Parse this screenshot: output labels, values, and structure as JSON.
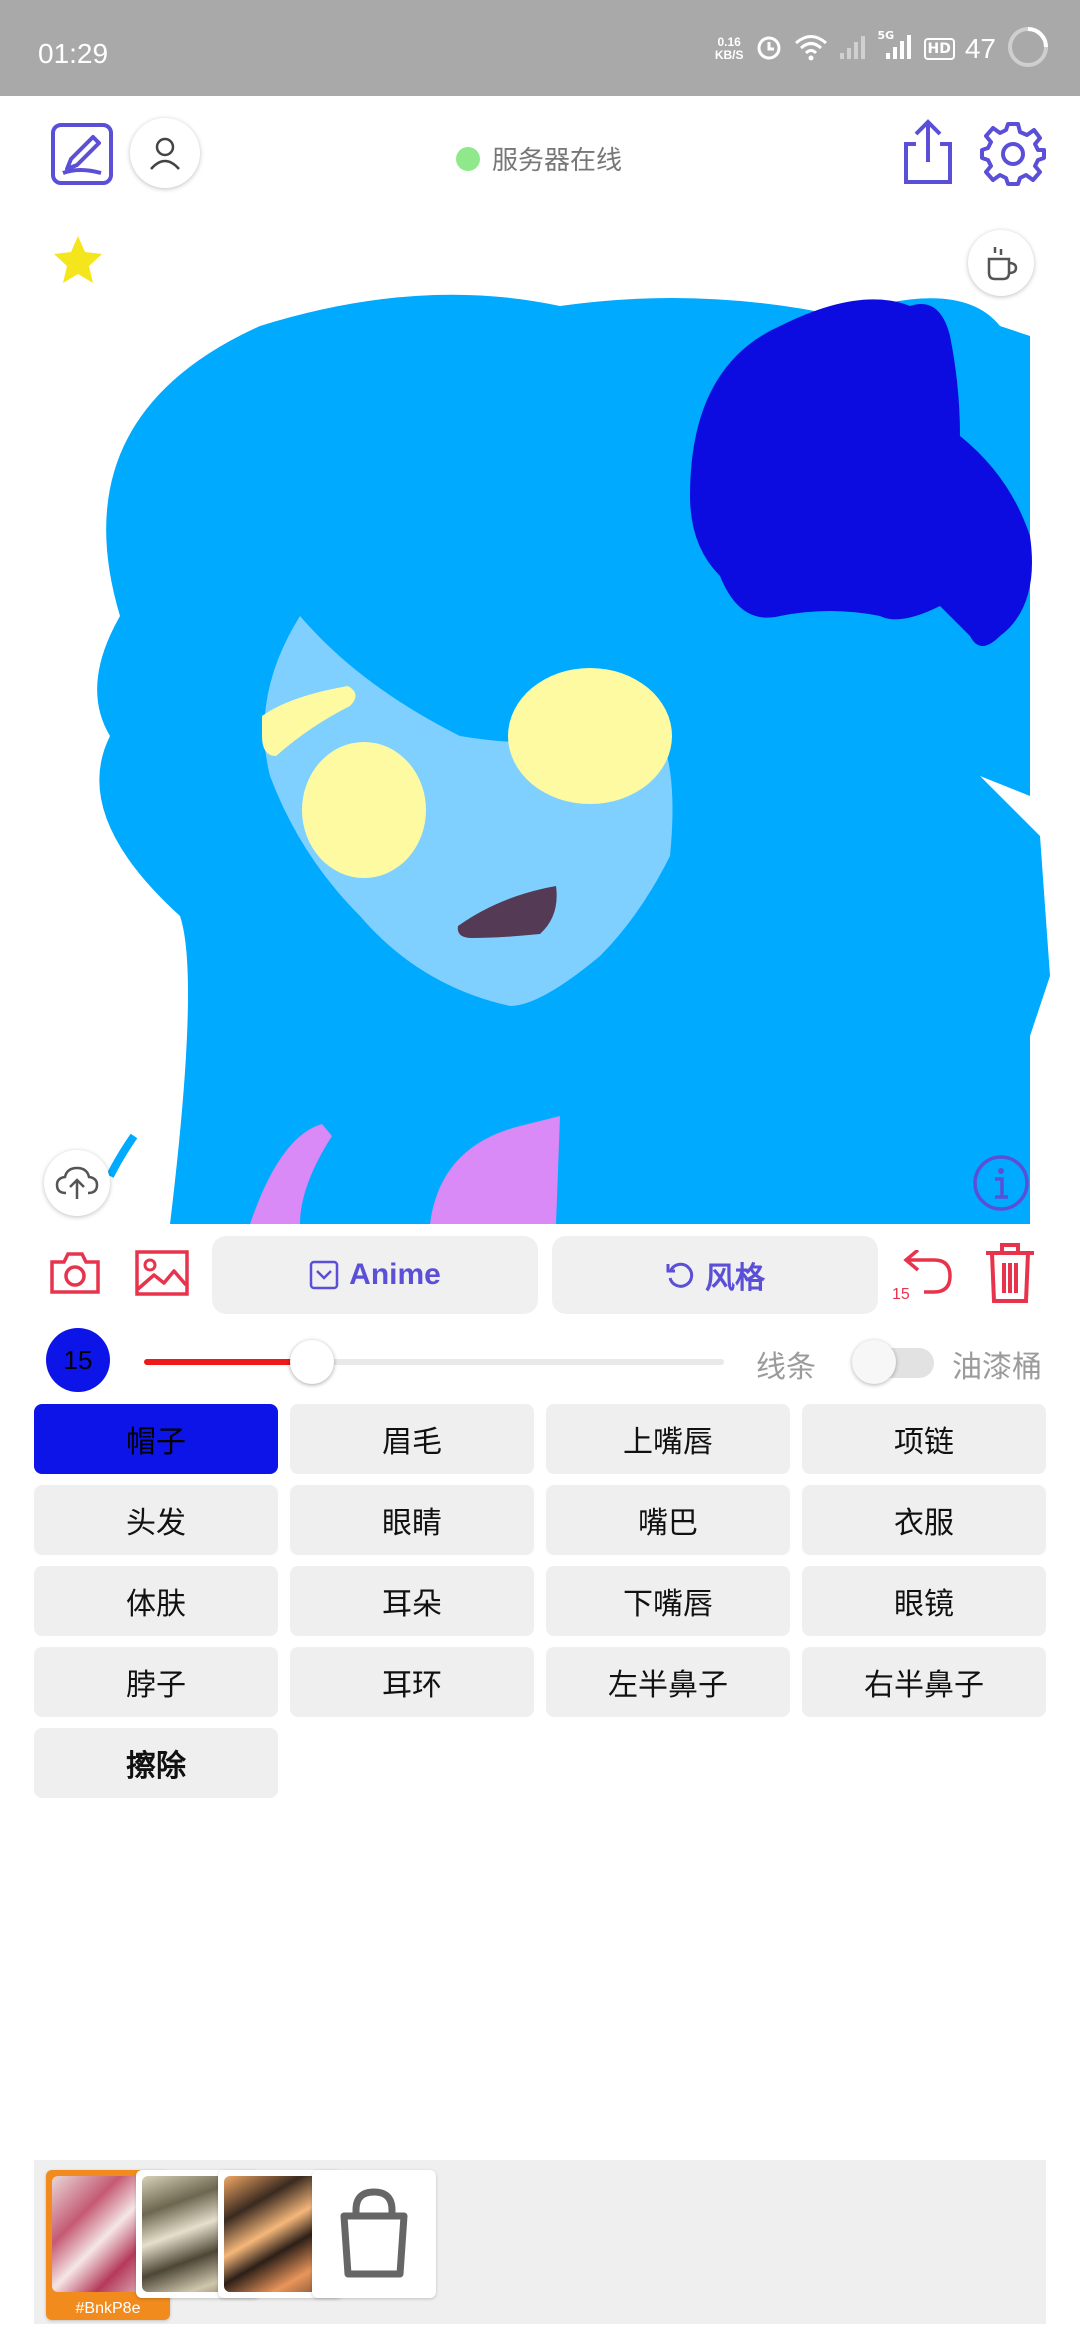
{
  "status_bar": {
    "time": "01:29",
    "net_speed_value": "0.16",
    "net_speed_unit": "KB/S",
    "network_type": "5G",
    "hd_label": "HD",
    "battery_level": "47"
  },
  "toolbar": {
    "server_status_text": "服务器在线",
    "server_status_color": "#8fe88a"
  },
  "canvas": {
    "background": "#ffffff",
    "hair_color": "#00aaff",
    "skin_color": "#7fd0ff",
    "hat_color": "#0c0ce0",
    "eye_color": "#fdfaa2",
    "mouth_color": "#553a55",
    "clothes_color": "#d98af7"
  },
  "tools": {
    "model_label": "Anime",
    "style_label": "风格",
    "undo_count": "15"
  },
  "brush": {
    "size": "15",
    "slider_fraction": 0.29,
    "color": "#0c14e8",
    "line_mode_label": "线条",
    "bucket_mode_label": "油漆桶",
    "bucket_enabled": false
  },
  "parts": [
    {
      "label": "帽子",
      "active": true
    },
    {
      "label": "眉毛",
      "active": false
    },
    {
      "label": "上嘴唇",
      "active": false
    },
    {
      "label": "项链",
      "active": false
    },
    {
      "label": "头发",
      "active": false
    },
    {
      "label": "眼睛",
      "active": false
    },
    {
      "label": "嘴巴",
      "active": false
    },
    {
      "label": "衣服",
      "active": false
    },
    {
      "label": "体肤",
      "active": false
    },
    {
      "label": "耳朵",
      "active": false
    },
    {
      "label": "下嘴唇",
      "active": false
    },
    {
      "label": "眼镜",
      "active": false
    },
    {
      "label": "脖子",
      "active": false
    },
    {
      "label": "耳环",
      "active": false
    },
    {
      "label": "左半鼻子",
      "active": false
    },
    {
      "label": "右半鼻子",
      "active": false
    },
    {
      "label": "擦除",
      "active": false
    }
  ],
  "styles": {
    "selected_tag": "#BnkP8e"
  },
  "colors": {
    "accent": "#5a4fd6",
    "danger": "#e8334d",
    "star": "#f5e51c"
  }
}
